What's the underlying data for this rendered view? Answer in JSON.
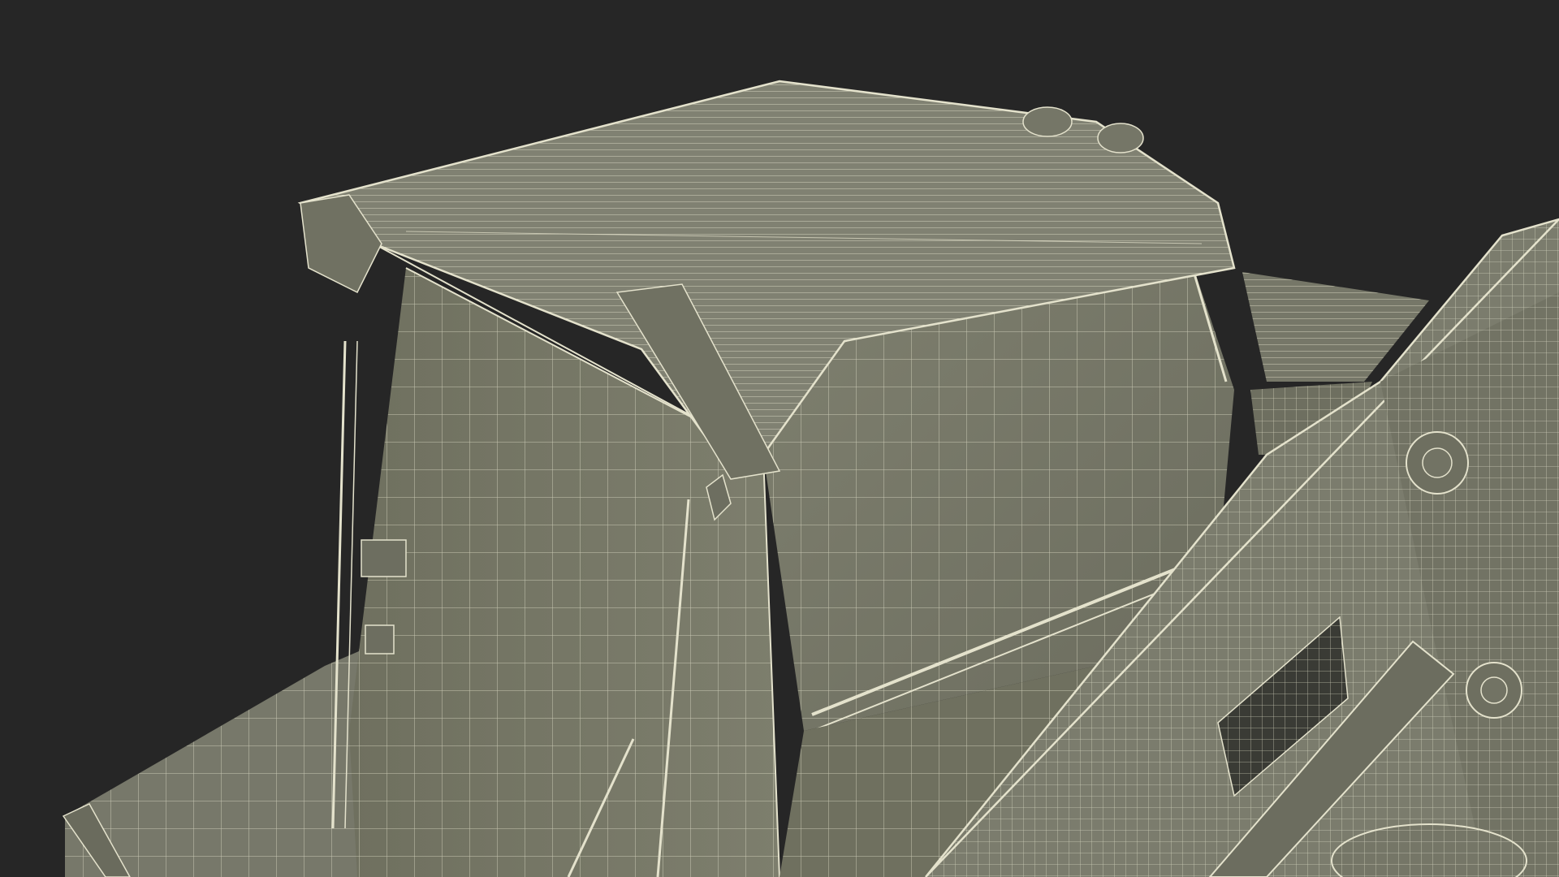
{
  "scene": {
    "background_color": "#262626",
    "fill_color": "#7a7b6c",
    "fill_shadow": "#6a6b5d",
    "wire_color": "#e4e2cc",
    "subject": "wireframe-compact-track-loader-cab"
  }
}
